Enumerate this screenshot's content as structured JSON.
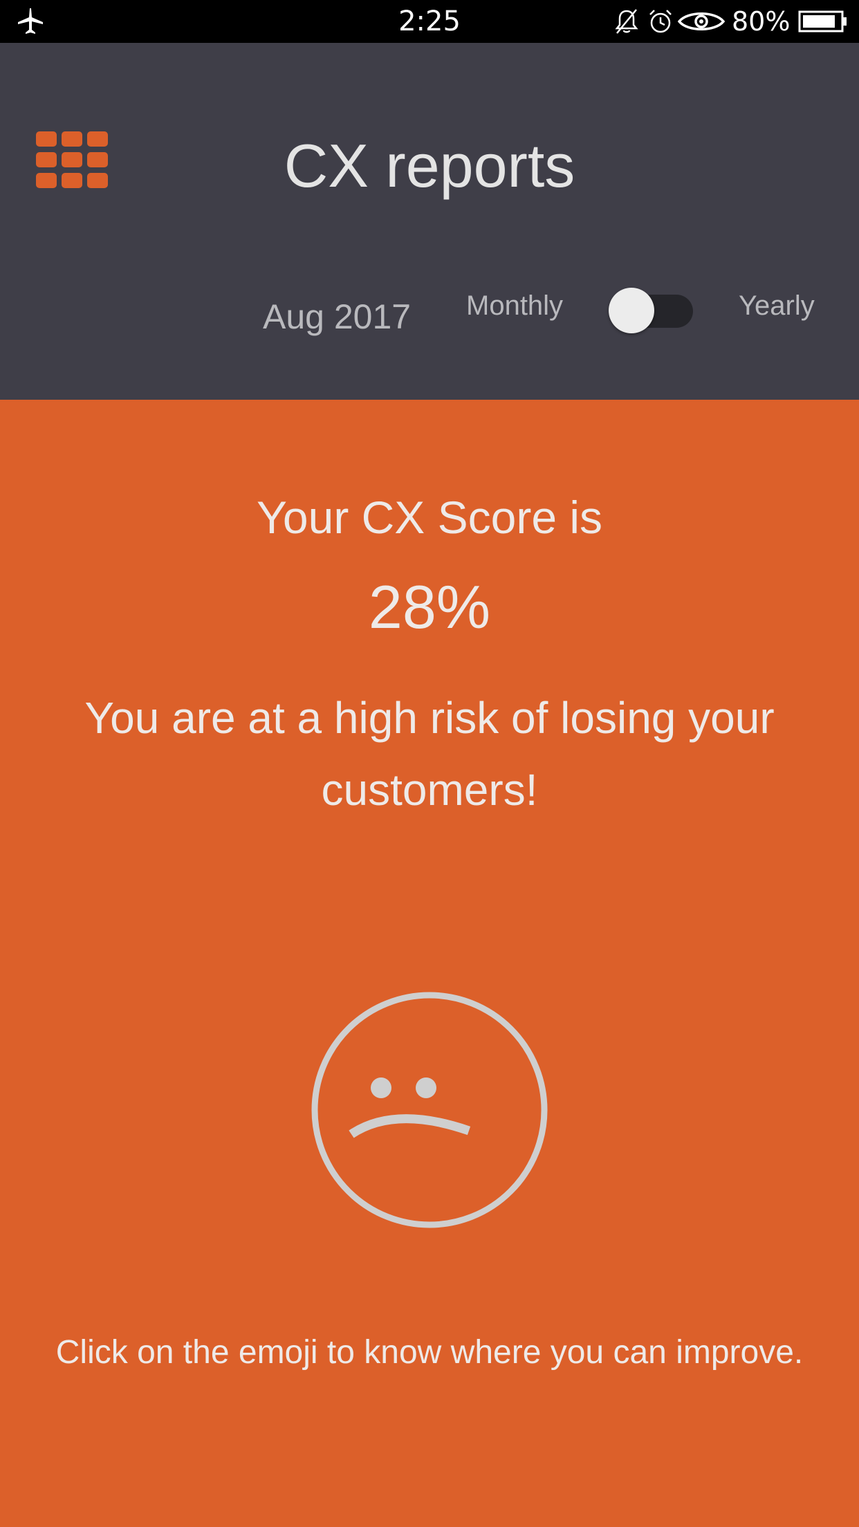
{
  "status_bar": {
    "time": "2:25",
    "battery_percent": "80%",
    "icons": [
      "airplane-mode-icon",
      "bell-muted-icon",
      "alarm-icon",
      "eye-icon",
      "battery-icon"
    ]
  },
  "header": {
    "title": "CX reports",
    "date": "Aug 2017",
    "toggle": {
      "left_label": "Monthly",
      "right_label": "Yearly",
      "selected": "Monthly"
    },
    "menu_icon": "grid-menu-icon"
  },
  "main": {
    "score_heading": "Your CX Score is",
    "score_value": "28%",
    "risk_message": "You are at a high risk of losing your customers!",
    "emoji": "sad-face-icon",
    "hint": "Click on the emoji to know where you can improve."
  },
  "colors": {
    "status_bar_bg": "#000000",
    "header_bg": "#3f3e48",
    "accent_orange": "#dc602a",
    "text_light": "#eeeae8",
    "emoji_stroke": "#cfcfcf",
    "toggle_track": "#25252a",
    "toggle_thumb": "#ececec"
  }
}
